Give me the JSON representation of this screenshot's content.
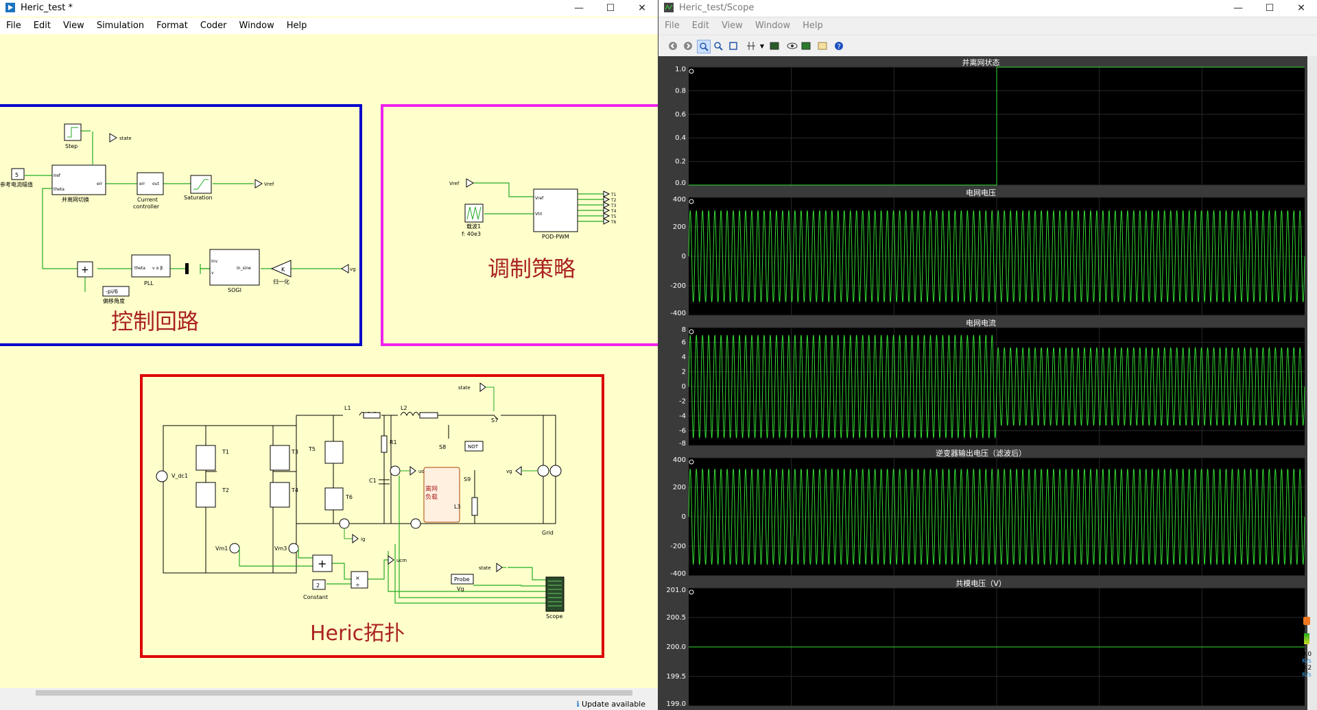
{
  "colors": {
    "canvas_bg": "#ffffcc",
    "block_control": "#0000cc",
    "block_modulation": "#ee22ee",
    "block_topology": "#dd0000",
    "wire": "#22aa22",
    "scope_trace": "#33dd33",
    "plot_bg": "#000000"
  },
  "left_window": {
    "title": "Heric_test *",
    "menu": [
      "File",
      "Edit",
      "View",
      "Simulation",
      "Format",
      "Coder",
      "Window",
      "Help"
    ],
    "status": "Update available",
    "diagram": {
      "control": {
        "title": "控制回路",
        "step": "Step",
        "state_out": "state",
        "ref_value": "5",
        "ref_label": "参考电流幅值",
        "switch_block": "并离网切换",
        "iref_port": "Iref",
        "theta_port": "theta",
        "state_port": "state",
        "err_port": "err",
        "controller_in": "err",
        "controller_out": "out",
        "controller_label_1": "Current",
        "controller_label_2": "controller",
        "saturation": "Saturation",
        "vref_out": "Vref",
        "pll_port_theta": "theta",
        "pll_port_v": "v α β",
        "pll": "PLL",
        "sogi_port_a": "Inv",
        "sogi_port_b": "v",
        "sogi_port_out": "In_sine",
        "sogi": "SOGI",
        "gain": "K",
        "normalize": "归一化",
        "vg_in": "vg",
        "offset_value": "-pi/6",
        "offset_label": "偏移角度"
      },
      "modulation": {
        "title": "调制策略",
        "vref_in": "Vref",
        "carrier": "载波1",
        "carrier_freq": "f: 40e3",
        "pod_port_vref": "Vref",
        "pod_port_vtri": "Vtri",
        "pod": "POD-PWM",
        "outputs": [
          "T1",
          "T2",
          "T3",
          "T4",
          "T5",
          "T6"
        ]
      },
      "topology": {
        "title": "Heric拓扑",
        "vdc": "V_dc1",
        "switches": [
          "T1",
          "T2",
          "T3",
          "T4",
          "T5",
          "T6"
        ],
        "L1": "L1",
        "L2": "L2",
        "L3": "L3",
        "R1": "R1",
        "C1": "C1",
        "S7": "S7",
        "S8": "S8",
        "S9": "S9",
        "NOT": "NOT",
        "state": "state",
        "load_1": "离网",
        "load_2": "负载",
        "vg": "vg",
        "grid": "Grid",
        "ig": "ig",
        "uo": "uo",
        "vm1": "Vm1",
        "vm3": "Vm3",
        "ucm": "ucm",
        "constant_value": "2",
        "constant": "Constant",
        "probe": "Probe",
        "probe_label": "Vg",
        "scope": "Scope"
      }
    }
  },
  "right_window": {
    "title": "Heric_test/Scope",
    "menu": [
      "File",
      "Edit",
      "View",
      "Window",
      "Help"
    ],
    "side_values": [
      "0.0",
      "K/s",
      "0.2",
      "K/s"
    ],
    "plots": [
      {
        "title": "并离网状态",
        "yticks": [
          "1.0",
          "0.8",
          "0.6",
          "0.4",
          "0.2",
          "0.0"
        ],
        "ylim": [
          0,
          1
        ],
        "kind": "step",
        "step_at": 0.5
      },
      {
        "title": "电网电压",
        "yticks": [
          "400",
          "200",
          "0",
          "-200",
          "-400"
        ],
        "ylim": [
          -400,
          400
        ],
        "kind": "sine",
        "amp": [
          311,
          311
        ]
      },
      {
        "title": "电网电流",
        "yticks": [
          "8",
          "6",
          "4",
          "2",
          "0",
          "-2",
          "-4",
          "-6",
          "-8"
        ],
        "ylim": [
          -8,
          8
        ],
        "kind": "sine",
        "amp": [
          7,
          5.3
        ]
      },
      {
        "title": "逆变器输出电压（滤波后）",
        "yticks": [
          "400",
          "200",
          "0",
          "-200",
          "-400"
        ],
        "ylim": [
          -400,
          400
        ],
        "kind": "sine",
        "amp": [
          325,
          325
        ]
      },
      {
        "title": "共模电压（V）",
        "yticks": [
          "201.0",
          "200.5",
          "200.0",
          "199.5",
          "199.0"
        ],
        "ylim": [
          199,
          201
        ],
        "kind": "flat",
        "level": 200
      }
    ]
  }
}
